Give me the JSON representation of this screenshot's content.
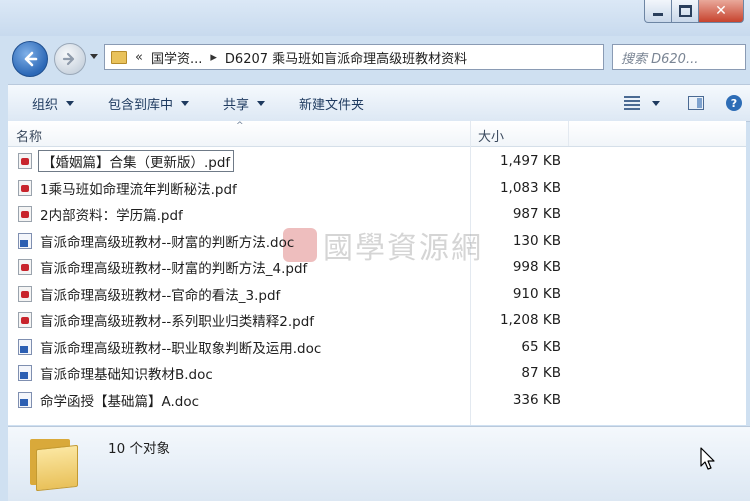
{
  "window": {
    "minimize_icon": "minimize-icon",
    "maximize_icon": "maximize-icon",
    "close_icon": "close-icon",
    "close_glyph": "✕"
  },
  "nav": {
    "back_icon": "back-arrow-icon",
    "forward_icon": "forward-arrow-icon",
    "breadcrumb_prefix": "«",
    "breadcrumb": [
      "国学资...",
      "D6207 乘马班如盲派命理高级班教材资料"
    ],
    "breadcrumb_sep": "▸",
    "search_placeholder": "搜索 D620..."
  },
  "toolbar": {
    "organize": "组织",
    "include_library": "包含到库中",
    "share": "共享",
    "new_folder": "新建文件夹",
    "help_glyph": "?"
  },
  "columns": {
    "name": "名称",
    "size": "大小",
    "sort_arrow": "^"
  },
  "files": [
    {
      "name": "【婚姻篇】合集（更新版）.pdf",
      "size": "1,497 KB",
      "type": "pdf",
      "focused": true
    },
    {
      "name": "1乘马班如命理流年判断秘法.pdf",
      "size": "1,083 KB",
      "type": "pdf"
    },
    {
      "name": "2内部资料：学历篇.pdf",
      "size": "987 KB",
      "type": "pdf"
    },
    {
      "name": "盲派命理高级班教材--财富的判断方法.doc",
      "size": "130 KB",
      "type": "doc"
    },
    {
      "name": "盲派命理高级班教材--财富的判断方法_4.pdf",
      "size": "998 KB",
      "type": "pdf"
    },
    {
      "name": "盲派命理高级班教材--官命的看法_3.pdf",
      "size": "910 KB",
      "type": "pdf"
    },
    {
      "name": "盲派命理高级班教材--系列职业归类精释2.pdf",
      "size": "1,208 KB",
      "type": "pdf"
    },
    {
      "name": "盲派命理高级班教材--职业取象判断及运用.doc",
      "size": "65 KB",
      "type": "doc"
    },
    {
      "name": "盲派命理基础知识教材B.doc",
      "size": "87 KB",
      "type": "doc"
    },
    {
      "name": "命学函授【基础篇】A.doc",
      "size": "336 KB",
      "type": "doc"
    }
  ],
  "watermark": "國學資源網",
  "details": {
    "count": "10 个对象",
    "folder_icon": "folder-icon"
  },
  "colors": {
    "accent": "#2c68b6",
    "pdf_red": "#c8242c",
    "doc_blue": "#2c5fb3"
  }
}
